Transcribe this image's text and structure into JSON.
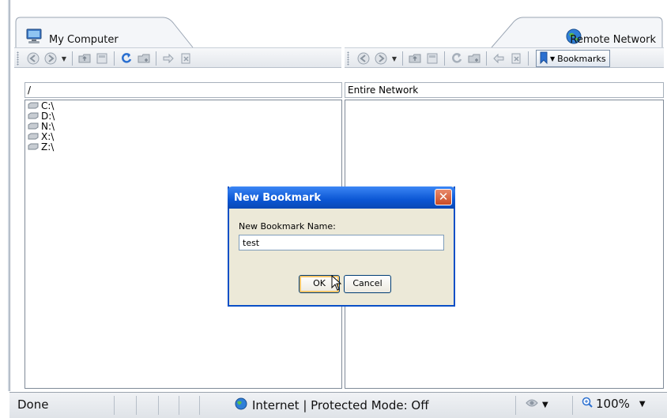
{
  "tabs": {
    "left": {
      "label": "My Computer",
      "icon": "computer-icon"
    },
    "right": {
      "label": "Remote Network",
      "icon": "globe-icon"
    }
  },
  "toolbar": {
    "bookmarks_label": "Bookmarks"
  },
  "left_panel": {
    "path": "/",
    "drives": [
      "C:\\",
      "D:\\",
      "N:\\",
      "X:\\",
      "Z:\\"
    ]
  },
  "right_panel": {
    "path": "Entire Network"
  },
  "dialog": {
    "title": "New Bookmark",
    "label": "New Bookmark Name:",
    "value": "test",
    "ok_label": "OK",
    "cancel_label": "Cancel"
  },
  "statusbar": {
    "status": "Done",
    "zone": "Internet | Protected Mode: Off",
    "zoom": "100%"
  },
  "colors": {
    "dialog_title": "#0b56d4",
    "dialog_body": "#ece9d8",
    "toolbar_bg": "#e3e7ec"
  }
}
